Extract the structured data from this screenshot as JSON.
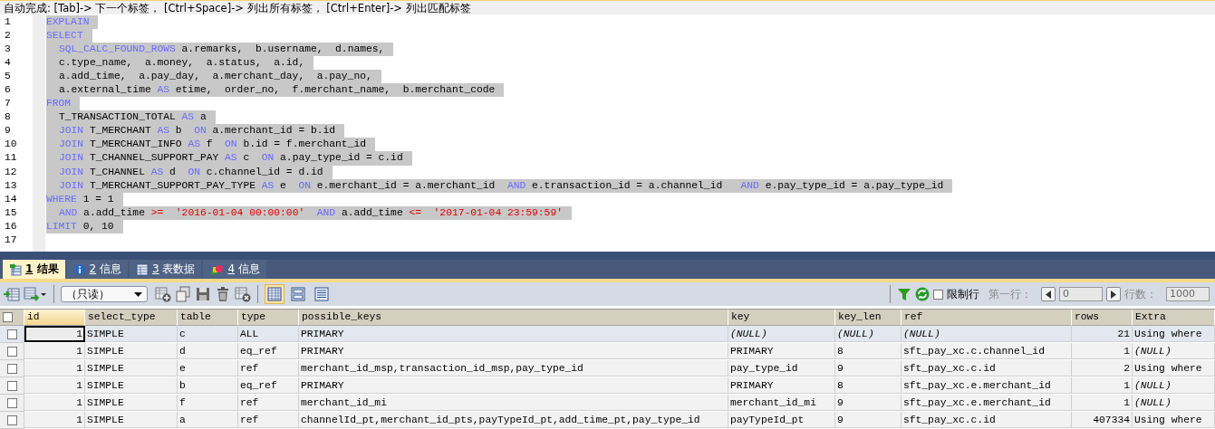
{
  "hint_bar": {
    "text": "自动完成: [Tab]-> 下一个标签， [Ctrl+Space]-> 列出所有标签， [Ctrl+Enter]-> 列出匹配标签"
  },
  "editor": {
    "lines": [
      {
        "number": "1",
        "indent": false,
        "selected": true,
        "tokens": [
          {
            "kind": "kw",
            "text": "EXPLAIN"
          }
        ]
      },
      {
        "number": "2",
        "indent": false,
        "selected": true,
        "tokens": [
          {
            "kind": "kw",
            "text": "SELECT"
          }
        ]
      },
      {
        "number": "3",
        "indent": true,
        "selected": true,
        "tokens": [
          {
            "kind": "kw",
            "text": "SQL_CALC_FOUND_ROWS"
          },
          {
            "kind": "plain",
            "text": " a.remarks,  b.username,  d.names,"
          }
        ]
      },
      {
        "number": "4",
        "indent": true,
        "selected": true,
        "tokens": [
          {
            "kind": "plain",
            "text": "c.type_name,  a.money,  a.status,  a.id,"
          }
        ]
      },
      {
        "number": "5",
        "indent": true,
        "selected": true,
        "tokens": [
          {
            "kind": "plain",
            "text": "a.add_time,  a.pay_day,  a.merchant_day,  a.pay_no,"
          }
        ]
      },
      {
        "number": "6",
        "indent": true,
        "selected": true,
        "tokens": [
          {
            "kind": "plain",
            "text": "a.external_time "
          },
          {
            "kind": "kw",
            "text": "AS"
          },
          {
            "kind": "plain",
            "text": " etime,  order_no,  f.merchant_name,  b.merchant_code"
          }
        ]
      },
      {
        "number": "7",
        "indent": false,
        "selected": true,
        "tokens": [
          {
            "kind": "kw",
            "text": "FROM"
          }
        ]
      },
      {
        "number": "8",
        "indent": true,
        "selected": true,
        "tokens": [
          {
            "kind": "plain",
            "text": "T_TRANSACTION_TOTAL "
          },
          {
            "kind": "kw",
            "text": "AS"
          },
          {
            "kind": "plain",
            "text": " a"
          }
        ]
      },
      {
        "number": "9",
        "indent": true,
        "selected": true,
        "tokens": [
          {
            "kind": "kw",
            "text": "JOIN"
          },
          {
            "kind": "plain",
            "text": " T_MERCHANT "
          },
          {
            "kind": "kw",
            "text": "AS"
          },
          {
            "kind": "plain",
            "text": " b  "
          },
          {
            "kind": "kw",
            "text": "ON"
          },
          {
            "kind": "plain",
            "text": " a.merchant_id = b.id"
          }
        ]
      },
      {
        "number": "10",
        "indent": true,
        "selected": true,
        "tokens": [
          {
            "kind": "kw",
            "text": "JOIN"
          },
          {
            "kind": "plain",
            "text": " T_MERCHANT_INFO "
          },
          {
            "kind": "kw",
            "text": "AS"
          },
          {
            "kind": "plain",
            "text": " f  "
          },
          {
            "kind": "kw",
            "text": "ON"
          },
          {
            "kind": "plain",
            "text": " b.id = f.merchant_id"
          }
        ]
      },
      {
        "number": "11",
        "indent": true,
        "selected": true,
        "tokens": [
          {
            "kind": "kw",
            "text": "JOIN"
          },
          {
            "kind": "plain",
            "text": " T_CHANNEL_SUPPORT_PAY "
          },
          {
            "kind": "kw",
            "text": "AS"
          },
          {
            "kind": "plain",
            "text": " c  "
          },
          {
            "kind": "kw",
            "text": "ON"
          },
          {
            "kind": "plain",
            "text": " a.pay_type_id = c.id"
          }
        ]
      },
      {
        "number": "12",
        "indent": true,
        "selected": true,
        "tokens": [
          {
            "kind": "kw",
            "text": "JOIN"
          },
          {
            "kind": "plain",
            "text": " T_CHANNEL "
          },
          {
            "kind": "kw",
            "text": "AS"
          },
          {
            "kind": "plain",
            "text": " d  "
          },
          {
            "kind": "kw",
            "text": "ON"
          },
          {
            "kind": "plain",
            "text": " c.channel_id = d.id"
          }
        ]
      },
      {
        "number": "13",
        "indent": true,
        "selected": true,
        "tokens": [
          {
            "kind": "kw",
            "text": "JOIN"
          },
          {
            "kind": "plain",
            "text": " T_MERCHANT_SUPPORT_PAY_TYPE "
          },
          {
            "kind": "kw",
            "text": "AS"
          },
          {
            "kind": "plain",
            "text": " e  "
          },
          {
            "kind": "kw",
            "text": "ON"
          },
          {
            "kind": "plain",
            "text": " e.merchant_id = a.merchant_id  "
          },
          {
            "kind": "kw",
            "text": "AND"
          },
          {
            "kind": "plain",
            "text": " e.transaction_id = a.channel_id   "
          },
          {
            "kind": "kw",
            "text": "AND"
          },
          {
            "kind": "plain",
            "text": " e.pay_type_id = a.pay_type_id"
          }
        ]
      },
      {
        "number": "14",
        "indent": false,
        "selected": true,
        "tokens": [
          {
            "kind": "kw",
            "text": "WHERE"
          },
          {
            "kind": "plain",
            "text": " 1 = 1"
          }
        ]
      },
      {
        "number": "15",
        "indent": true,
        "selected": true,
        "tokens": [
          {
            "kind": "kw",
            "text": "AND"
          },
          {
            "kind": "plain",
            "text": " a.add_time "
          },
          {
            "kind": "op",
            "text": ">="
          },
          {
            "kind": "str",
            "text": "  '2016-01-04 00:00:00'"
          },
          {
            "kind": "kw",
            "text": "  AND"
          },
          {
            "kind": "plain",
            "text": " a.add_time "
          },
          {
            "kind": "op",
            "text": "<="
          },
          {
            "kind": "str",
            "text": "  '2017-01-04 23:59:59'"
          }
        ]
      },
      {
        "number": "16",
        "indent": false,
        "selected": true,
        "tokens": [
          {
            "kind": "kw",
            "text": "LIMIT"
          },
          {
            "kind": "plain",
            "text": " 0, 10"
          }
        ]
      },
      {
        "number": "17"
      }
    ]
  },
  "tabs": [
    {
      "number": "1",
      "label": "结果",
      "selected": true
    },
    {
      "number": "2",
      "label": "信息",
      "selected": false
    },
    {
      "number": "3",
      "label": "表数据",
      "selected": false
    },
    {
      "number": "4",
      "label": "信息",
      "selected": false
    }
  ],
  "toolbar": {
    "mode_dropdown": "（只读）",
    "view_modes": [
      {
        "selected": true
      },
      {
        "selected": false
      },
      {
        "selected": false
      }
    ],
    "limit_rows": {
      "label": "限制行",
      "checked": false
    },
    "first_row_label": "第一行：",
    "first_row_value": "0",
    "row_count_label": "行数：",
    "row_count_value": "1000"
  },
  "table": {
    "select_all_checked": false,
    "columns": [
      {
        "label": "id",
        "kind": "number"
      },
      {
        "label": "select_type",
        "kind": "text"
      },
      {
        "label": "table",
        "kind": "text"
      },
      {
        "label": "type",
        "kind": "text"
      },
      {
        "label": "possible_keys",
        "kind": "text"
      },
      {
        "label": "key",
        "kind": "text"
      },
      {
        "label": "key_len",
        "kind": "text"
      },
      {
        "label": "ref",
        "kind": "text"
      },
      {
        "label": "rows",
        "kind": "number"
      },
      {
        "label": "Extra",
        "kind": "text"
      }
    ],
    "rows": [
      {
        "selected": true,
        "checked": false,
        "cells": [
          {
            "text": "1"
          },
          {
            "text": "SIMPLE"
          },
          {
            "text": "c"
          },
          {
            "text": "ALL"
          },
          {
            "text": "PRIMARY"
          },
          {
            "text": "(NULL)",
            "null": true
          },
          {
            "text": "(NULL)",
            "null": true
          },
          {
            "text": "(NULL)",
            "null": true
          },
          {
            "text": "21"
          },
          {
            "text": "Using where"
          }
        ]
      },
      {
        "selected": false,
        "checked": false,
        "cells": [
          {
            "text": "1"
          },
          {
            "text": "SIMPLE"
          },
          {
            "text": "d"
          },
          {
            "text": "eq_ref"
          },
          {
            "text": "PRIMARY"
          },
          {
            "text": "PRIMARY"
          },
          {
            "text": "8"
          },
          {
            "text": "sft_pay_xc.c.channel_id"
          },
          {
            "text": "1"
          },
          {
            "text": "(NULL)",
            "null": true
          }
        ]
      },
      {
        "selected": false,
        "checked": false,
        "cells": [
          {
            "text": "1"
          },
          {
            "text": "SIMPLE"
          },
          {
            "text": "e"
          },
          {
            "text": "ref"
          },
          {
            "text": "merchant_id_msp,transaction_id_msp,pay_type_id"
          },
          {
            "text": "pay_type_id"
          },
          {
            "text": "9"
          },
          {
            "text": "sft_pay_xc.c.id"
          },
          {
            "text": "2"
          },
          {
            "text": "Using where"
          }
        ]
      },
      {
        "selected": false,
        "checked": false,
        "cells": [
          {
            "text": "1"
          },
          {
            "text": "SIMPLE"
          },
          {
            "text": "b"
          },
          {
            "text": "eq_ref"
          },
          {
            "text": "PRIMARY"
          },
          {
            "text": "PRIMARY"
          },
          {
            "text": "8"
          },
          {
            "text": "sft_pay_xc.e.merchant_id"
          },
          {
            "text": "1"
          },
          {
            "text": "(NULL)",
            "null": true
          }
        ]
      },
      {
        "selected": false,
        "checked": false,
        "cells": [
          {
            "text": "1"
          },
          {
            "text": "SIMPLE"
          },
          {
            "text": "f"
          },
          {
            "text": "ref"
          },
          {
            "text": "merchant_id_mi"
          },
          {
            "text": "merchant_id_mi"
          },
          {
            "text": "9"
          },
          {
            "text": "sft_pay_xc.e.merchant_id"
          },
          {
            "text": "1"
          },
          {
            "text": "(NULL)",
            "null": true
          }
        ]
      },
      {
        "selected": false,
        "checked": false,
        "cells": [
          {
            "text": "1"
          },
          {
            "text": "SIMPLE"
          },
          {
            "text": "a"
          },
          {
            "text": "ref"
          },
          {
            "text": "channelId_pt,merchant_id_pts,payTypeId_pt,add_time_pt,pay_type_id"
          },
          {
            "text": "payTypeId_pt"
          },
          {
            "text": "9"
          },
          {
            "text": "sft_pay_xc.c.id"
          },
          {
            "text": "407334"
          },
          {
            "text": "Using where"
          }
        ]
      }
    ]
  }
}
